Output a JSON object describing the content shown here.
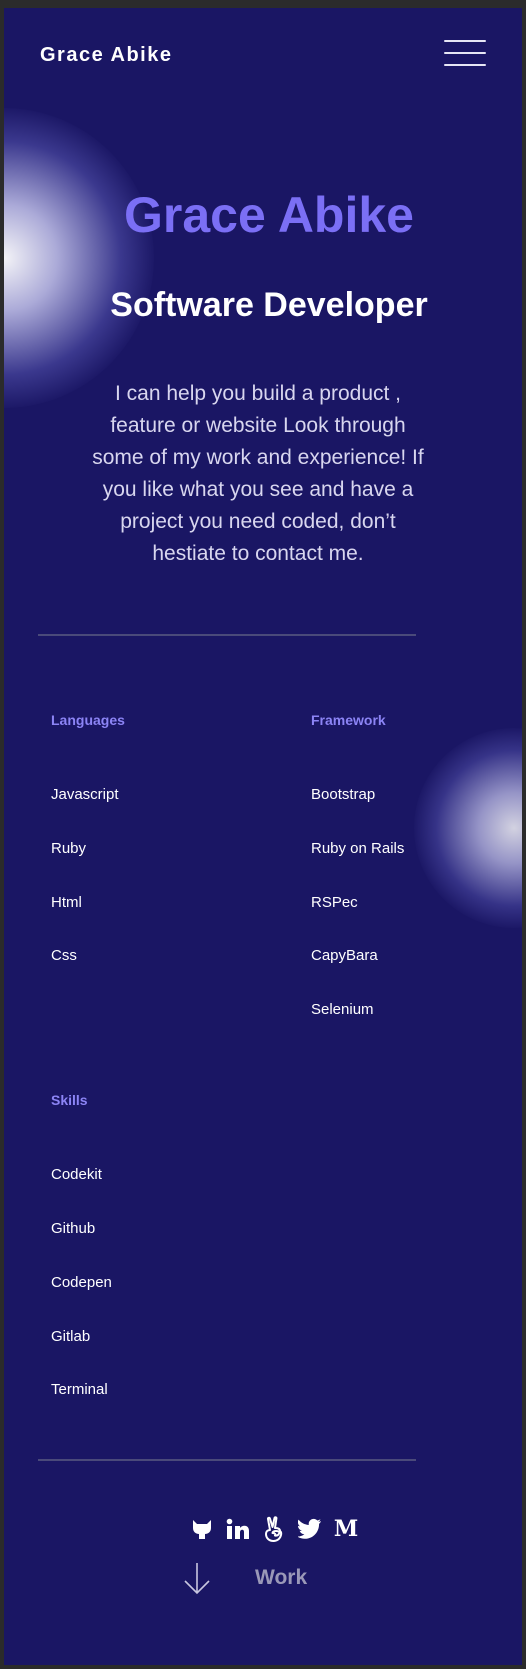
{
  "header": {
    "brand": "Grace Abike",
    "menu_icon": "hamburger-menu-icon"
  },
  "hero": {
    "name": "Grace Abike",
    "role": "Software Developer",
    "intro": "I can help you build a product , feature or website Look through some of my work and experience! If you like what you see and have a project you need coded, don’t hestiate to contact me."
  },
  "skills": {
    "languages": {
      "title": "Languages",
      "items": [
        "Javascript",
        "Ruby",
        "Html",
        "Css"
      ]
    },
    "framework": {
      "title": "Framework",
      "items": [
        "Bootstrap",
        "Ruby on Rails",
        "RSPec",
        "CapyBara",
        "Selenium"
      ]
    },
    "tools": {
      "title": "Skills",
      "items": [
        "Codekit",
        "Github",
        "Codepen",
        "Gitlab",
        "Terminal"
      ]
    }
  },
  "socials": {
    "icons": [
      "github-icon",
      "linkedin-icon",
      "angellist-icon",
      "twitter-icon",
      "medium-icon"
    ],
    "medium_glyph": "M"
  },
  "footer": {
    "arrow_icon": "arrow-down-icon",
    "work_label": "Work"
  },
  "colors": {
    "background": "#1a1664",
    "accent": "#7b6ff5",
    "heading_accent": "#8c84f5",
    "text": "#ffffff",
    "muted": "#9a98b8"
  }
}
